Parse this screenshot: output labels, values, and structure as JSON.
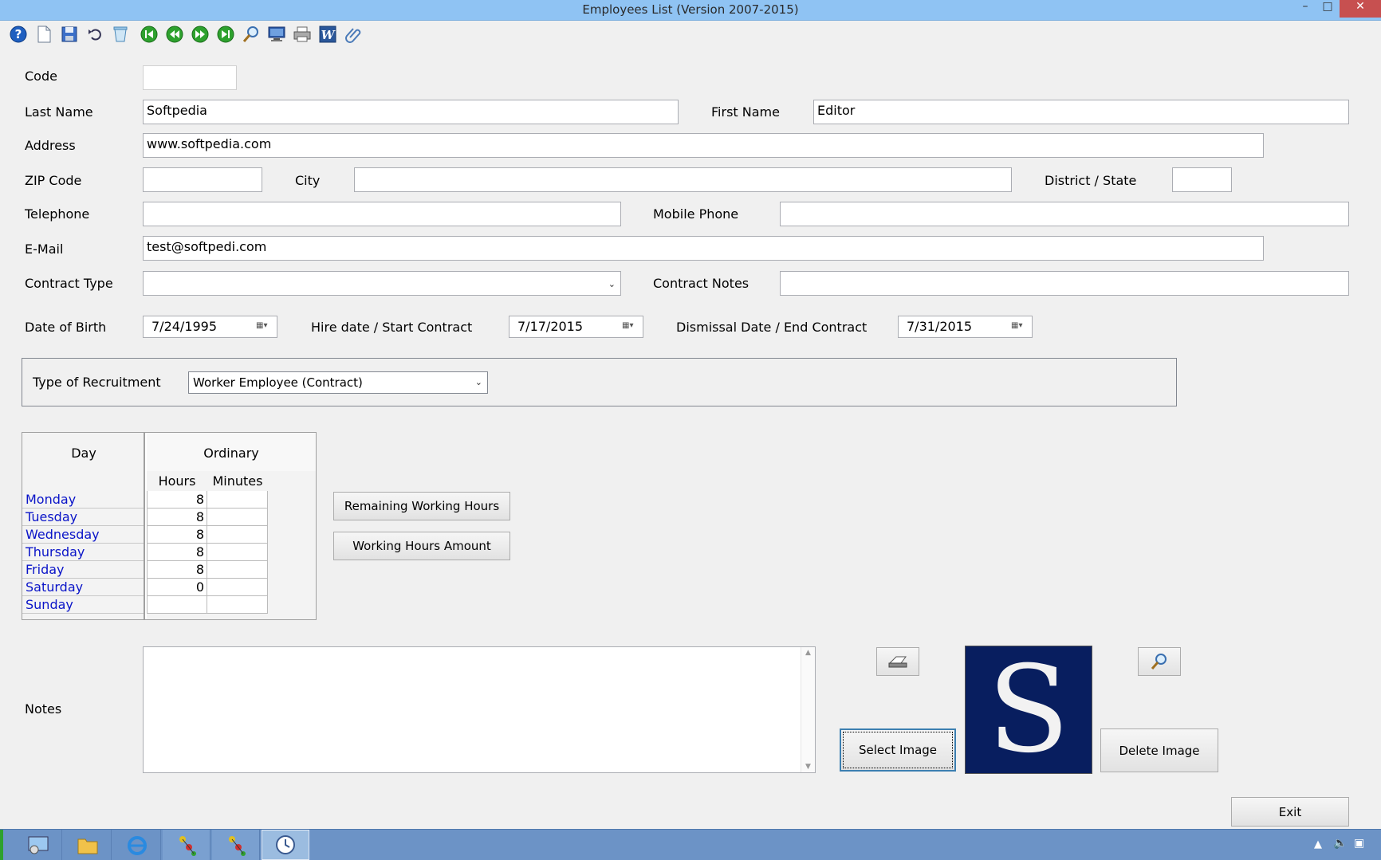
{
  "window": {
    "title": "Employees List (Version 2007-2015)",
    "minimize": "–",
    "maximize": "□",
    "close": "✕"
  },
  "toolbar": [
    "help-icon",
    "new-document-icon",
    "save-icon",
    "undo-icon",
    "delete-icon",
    "first-record-icon",
    "previous-record-icon",
    "next-record-icon",
    "last-record-icon",
    "search-icon",
    "preview-icon",
    "print-icon",
    "word-export-icon",
    "attach-icon"
  ],
  "form": {
    "code": {
      "label": "Code",
      "value": ""
    },
    "last_name": {
      "label": "Last Name",
      "value": "Softpedia"
    },
    "first_name": {
      "label": "First Name",
      "value": "Editor"
    },
    "address": {
      "label": "Address",
      "value": "www.softpedia.com"
    },
    "zip": {
      "label": "ZIP Code",
      "value": ""
    },
    "city": {
      "label": "City",
      "value": ""
    },
    "state": {
      "label": "District / State",
      "value": ""
    },
    "telephone": {
      "label": "Telephone",
      "value": ""
    },
    "mobile": {
      "label": "Mobile Phone",
      "value": ""
    },
    "email": {
      "label": "E-Mail",
      "value": "test@softpedi.com"
    },
    "contract_type": {
      "label": "Contract Type",
      "value": ""
    },
    "contract_notes": {
      "label": "Contract Notes",
      "value": ""
    },
    "dob": {
      "label": "Date of Birth",
      "value": "7/24/1995"
    },
    "hire": {
      "label": "Hire date / Start Contract",
      "value": "7/17/2015"
    },
    "dismissal": {
      "label": "Dismissal Date / End Contract",
      "value": "7/31/2015"
    },
    "recruitment": {
      "label": "Type of Recruitment",
      "value": "Worker Employee (Contract)"
    },
    "notes": {
      "label": "Notes",
      "value": ""
    }
  },
  "hours_grid": {
    "day_header": "Day",
    "ordinary_header": "Ordinary",
    "hours_header": "Hours",
    "minutes_header": "Minutes",
    "rows": [
      {
        "day": "Monday",
        "hours": "8",
        "minutes": ""
      },
      {
        "day": "Tuesday",
        "hours": "8",
        "minutes": ""
      },
      {
        "day": "Wednesday",
        "hours": "8",
        "minutes": ""
      },
      {
        "day": "Thursday",
        "hours": "8",
        "minutes": ""
      },
      {
        "day": "Friday",
        "hours": "8",
        "minutes": ""
      },
      {
        "day": "Saturday",
        "hours": "0",
        "minutes": ""
      },
      {
        "day": "Sunday",
        "hours": "",
        "minutes": ""
      }
    ]
  },
  "buttons": {
    "remaining": "Remaining Working Hours",
    "amount": "Working Hours Amount",
    "select_image": "Select Image",
    "delete_image": "Delete Image",
    "exit": "Exit"
  },
  "image": {
    "letter": "S"
  },
  "colors": {
    "titlebar": "#8fc3f3",
    "day_text": "#0a14c8",
    "image_bg": "#081e5f",
    "taskbar": "#6c93c6"
  }
}
